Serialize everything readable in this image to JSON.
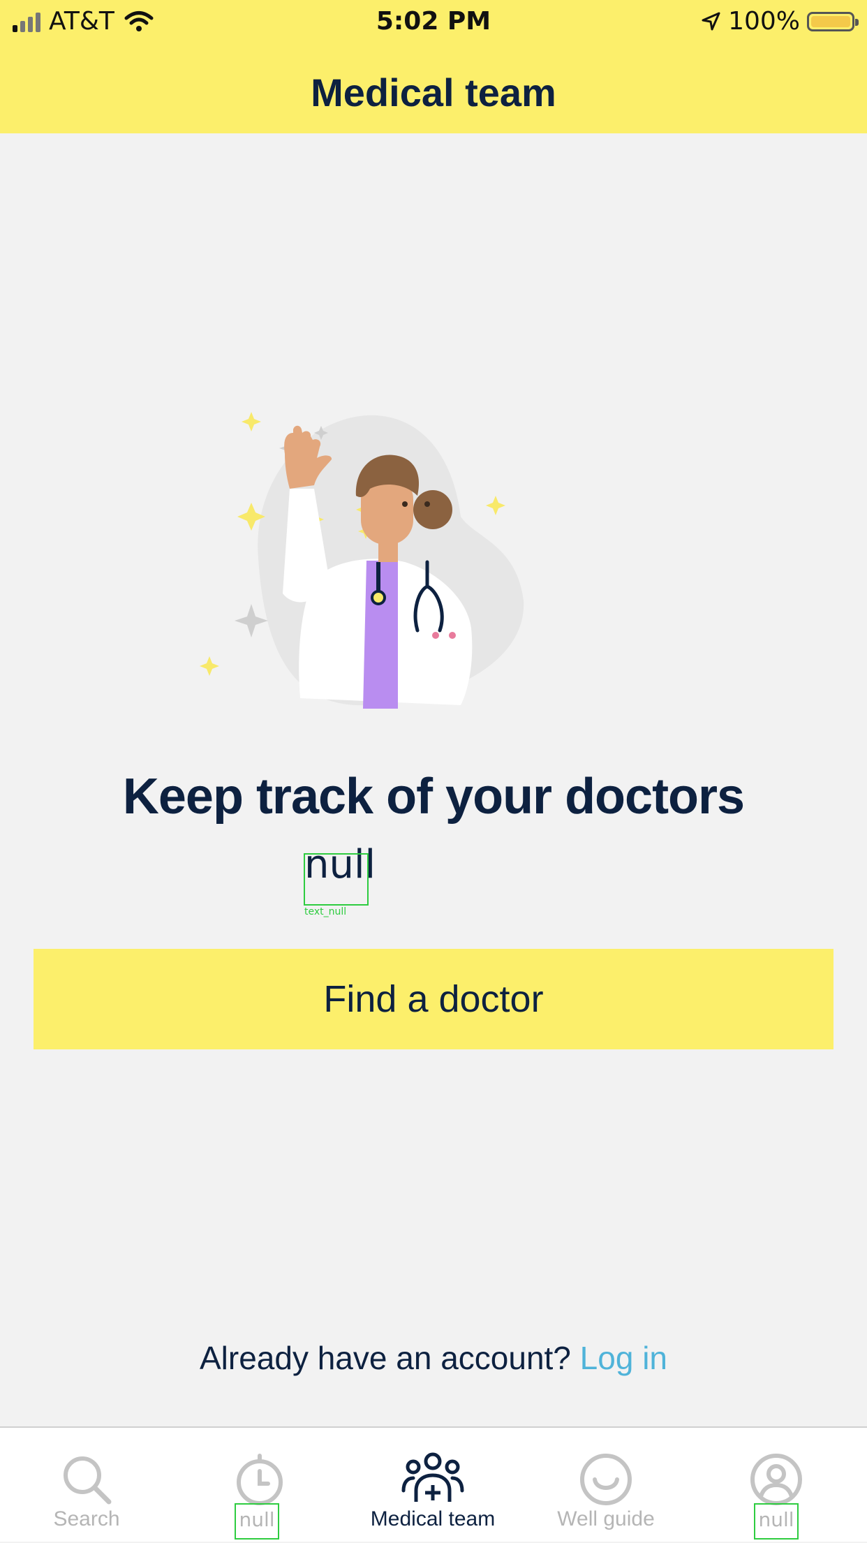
{
  "status_bar": {
    "carrier": "AT&T",
    "time": "5:02 PM",
    "battery": "100%"
  },
  "header": {
    "title": "Medical team"
  },
  "main": {
    "headline": "Keep track of your doctors",
    "subtext": "null",
    "debug_label": "text_null",
    "cta_label": "Find a doctor",
    "login_prompt": "Already have an account?",
    "login_link": "Log in"
  },
  "tab_bar": {
    "tabs": [
      {
        "label": "Search",
        "icon": "search-icon",
        "active": false
      },
      {
        "label": "null",
        "icon": "timer-icon",
        "active": false
      },
      {
        "label": "Medical team",
        "icon": "medical-team-icon",
        "active": true
      },
      {
        "label": "Well guide",
        "icon": "smile-icon",
        "active": false
      },
      {
        "label": "null",
        "icon": "profile-icon",
        "active": false
      }
    ]
  },
  "colors": {
    "header_bg": "#fcef6b",
    "page_bg": "#f2f2f2",
    "text_dark": "#0d2140",
    "link": "#4fb3d9",
    "tab_inactive": "#b5b5b5",
    "debug": "#2ecc40"
  }
}
